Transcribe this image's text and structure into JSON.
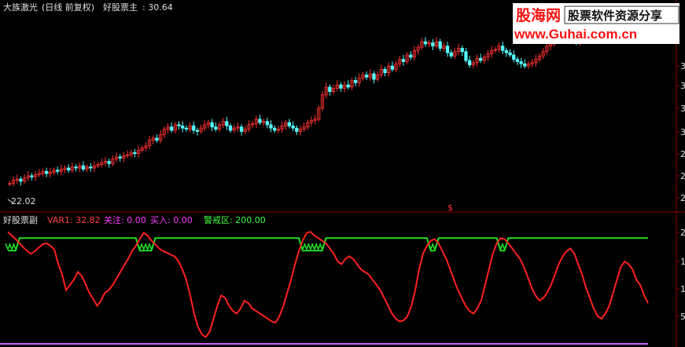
{
  "title_bar": {
    "stock_name": "大族激光",
    "period": "(日线 前复权)",
    "main_indicator": "好股票主",
    "main_value": ": 30.64"
  },
  "sub_bar": {
    "indicator_name": "好股票副",
    "var1_label": "VAR1: 32.82",
    "watch_label": "关注: 0.00",
    "buy_label": "买入: 0.00",
    "alert_label": "警戒区: 200.00"
  },
  "watermark": {
    "brand_cn": "股海网",
    "slogan": "股票软件资源分享",
    "url": "www.Guhai.com.cn"
  },
  "price_annotation": "22.02",
  "dollar_marker": "$",
  "colors": {
    "up": "#ff3232",
    "down": "#54ffff",
    "line_red": "#ff2020",
    "line_green": "#22dd22",
    "line_purple": "#d060ff",
    "panel_border": "#8a0000",
    "text_var1": "#ff4040",
    "text_watch": "#ff40ff",
    "text_buy": "#ff40ff",
    "text_alert": "#40ff40",
    "text_white": "#e0e0e0"
  },
  "right_axis_main": [
    "3",
    "3",
    "3",
    "3",
    "2",
    "2",
    "2"
  ],
  "right_axis_sub": [
    "2",
    "1",
    "1",
    "5"
  ],
  "chart_data": [
    {
      "type": "candlestick",
      "title": "大族激光(日线 前复权)",
      "x_range": [
        0,
        195
      ],
      "y_range": [
        20,
        37
      ],
      "close": [
        22.0,
        22.3,
        22.4,
        22.2,
        22.5,
        22.7,
        22.6,
        22.8,
        22.9,
        23.1,
        22.9,
        23.0,
        23.2,
        23.1,
        23.3,
        23.4,
        23.2,
        23.5,
        23.4,
        23.6,
        23.3,
        23.5,
        23.4,
        23.6,
        23.7,
        23.9,
        24.0,
        23.8,
        24.2,
        24.4,
        24.3,
        24.5,
        24.6,
        24.8,
        24.7,
        25.0,
        25.2,
        25.4,
        25.9,
        26.1,
        25.9,
        26.4,
        26.9,
        27.1,
        26.8,
        27.3,
        27.2,
        27.0,
        26.9,
        27.2,
        26.8,
        26.7,
        27.0,
        27.3,
        27.5,
        27.1,
        26.9,
        27.3,
        27.6,
        27.2,
        26.8,
        27.0,
        27.1,
        26.7,
        26.9,
        27.3,
        27.4,
        27.8,
        27.5,
        27.6,
        27.3,
        27.0,
        26.8,
        26.9,
        27.2,
        27.5,
        27.2,
        27.0,
        26.7,
        26.9,
        27.1,
        27.5,
        27.7,
        27.8,
        28.8,
        30.0,
        30.7,
        30.3,
        30.6,
        30.9,
        30.6,
        30.9,
        30.7,
        31.3,
        31.1,
        31.5,
        31.8,
        31.6,
        31.9,
        31.4,
        31.8,
        32.3,
        32.0,
        32.6,
        32.3,
        32.8,
        33.2,
        33.0,
        33.6,
        33.4,
        34.0,
        34.3,
        34.8,
        34.6,
        34.7,
        34.4,
        34.8,
        34.2,
        34.4,
        33.8,
        33.5,
        33.9,
        34.2,
        33.9,
        33.1,
        32.7,
        32.9,
        33.3,
        33.1,
        33.4,
        33.7,
        34.0,
        34.1,
        34.4,
        34.0,
        33.8,
        33.6,
        33.2,
        33.0,
        32.8,
        32.6,
        32.8,
        32.9,
        33.2,
        33.5,
        33.9,
        34.4,
        34.6,
        35.2,
        35.0,
        35.8,
        35.6,
        35.4,
        35.0,
        34.8,
        35.1,
        35.5,
        35.9,
        36.2,
        36.8,
        37.2,
        37.4,
        37.6,
        37.3,
        37.7,
        37.5,
        37.4,
        37.6,
        37.2,
        37.0,
        37.3,
        36.8,
        37.2,
        37.4
      ]
    },
    {
      "type": "line",
      "title": "好股票副",
      "y_range": [
        0,
        220
      ],
      "series": [
        {
          "name": "VAR1",
          "values": [
            212,
            205,
            198,
            190,
            182,
            175,
            170,
            175,
            182,
            188,
            190,
            185,
            178,
            150,
            130,
            100,
            110,
            120,
            135,
            128,
            112,
            95,
            83,
            70,
            80,
            95,
            100,
            110,
            122,
            135,
            148,
            160,
            175,
            185,
            198,
            210,
            205,
            195,
            188,
            180,
            175,
            172,
            168,
            165,
            155,
            140,
            120,
            90,
            55,
            30,
            15,
            10,
            20,
            45,
            70,
            90,
            85,
            70,
            60,
            55,
            65,
            80,
            75,
            65,
            60,
            55,
            50,
            45,
            40,
            38,
            50,
            70,
            95,
            120,
            150,
            175,
            195,
            210,
            212,
            205,
            200,
            195,
            190,
            180,
            170,
            155,
            150,
            160,
            165,
            160,
            150,
            140,
            135,
            130,
            120,
            110,
            100,
            85,
            70,
            55,
            45,
            40,
            42,
            50,
            70,
            100,
            140,
            170,
            185,
            195,
            198,
            190,
            175,
            160,
            140,
            120,
            100,
            85,
            70,
            60,
            55,
            65,
            80,
            110,
            140,
            170,
            190,
            200,
            198,
            190,
            180,
            170,
            160,
            145,
            125,
            105,
            90,
            80,
            85,
            95,
            110,
            130,
            150,
            165,
            175,
            180,
            170,
            150,
            130,
            105,
            85,
            65,
            50,
            45,
            55,
            70,
            95,
            120,
            145,
            155,
            150,
            140,
            120,
            110,
            90,
            75
          ]
        },
        {
          "name": "警戒区",
          "values": [
            200,
            200,
            200,
            200,
            200,
            200,
            200,
            200,
            200,
            200,
            200,
            200,
            200,
            200,
            200,
            200,
            200,
            200,
            200,
            200,
            200,
            200,
            200,
            200,
            200,
            200,
            200,
            200,
            200,
            200,
            200,
            200,
            200,
            200,
            200,
            200,
            200,
            200,
            200,
            200,
            200,
            200,
            200,
            200,
            200,
            200,
            200,
            200,
            200,
            200,
            200,
            200,
            200,
            200,
            200,
            200,
            200,
            200,
            200,
            200,
            200,
            200,
            200,
            200,
            200,
            200,
            200,
            200,
            200,
            200,
            200,
            200,
            200,
            200,
            200,
            200,
            200,
            200,
            200,
            200,
            200,
            200,
            200,
            200,
            200,
            200,
            200,
            200,
            200,
            200,
            200,
            200,
            200,
            200,
            200,
            200,
            200,
            200,
            200,
            200,
            200,
            200,
            200,
            200,
            200,
            200,
            200,
            200,
            200,
            200,
            200,
            200,
            200,
            200,
            200,
            200,
            200,
            200,
            200,
            200,
            200,
            200,
            200,
            200,
            200,
            200,
            200,
            200,
            200,
            200,
            200,
            200,
            200,
            200,
            200,
            200,
            200,
            200,
            200,
            200,
            200,
            200,
            200,
            200,
            200,
            200,
            200,
            200,
            200,
            200,
            200,
            200,
            200,
            200,
            200,
            200,
            200,
            200,
            200,
            200,
            200,
            200,
            200,
            200,
            200,
            200
          ]
        }
      ]
    }
  ]
}
